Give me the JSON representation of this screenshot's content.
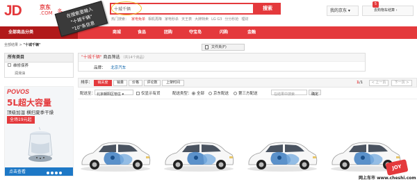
{
  "header": {
    "logo": {
      "brand": "JD",
      "cn": "京东",
      "com": ".COM",
      "more": "多"
    },
    "search": {
      "value": "十城千辆",
      "button": "搜索"
    },
    "hot_words": [
      {
        "text": "热门搜索：",
        "hot": false
      },
      {
        "text": "家电免单",
        "hot": true
      },
      {
        "text": "相机再降",
        "hot": false
      },
      {
        "text": "家电秒杀",
        "hot": false
      },
      {
        "text": "天王表",
        "hot": false
      },
      {
        "text": "大牌特卖",
        "hot": false
      },
      {
        "text": "LG G3",
        "hot": false
      },
      {
        "text": "分分秒抢",
        "hot": false
      },
      {
        "text": "理财",
        "hot": false
      }
    ],
    "my_jd": "我的京东 ▾",
    "cart": {
      "label": "去购物车结算 ›",
      "count": "5"
    }
  },
  "overlay": {
    "lines": [
      "在搜索里输入",
      "\"十城千辆\"",
      "\"10\"条信息"
    ]
  },
  "nav": {
    "all_categories": "全部商品分类",
    "items": [
      "商城",
      "食品",
      "团购",
      "夺宝岛",
      "闪购",
      "金融"
    ]
  },
  "breadcrumb": {
    "prefix": "全部结果",
    "sep": " > ",
    "keyword": "\"十城千辆\""
  },
  "file_button": "文件夹(F)",
  "sidebar": {
    "title": "所有类目",
    "item": "维修保养",
    "sub": "润滑油"
  },
  "ad": {
    "brand": "POVOS",
    "headline": "5L超大容量",
    "sub": "顶级加湿 横扫夏季干燥",
    "price": "全场19元起",
    "footer": "点击查看"
  },
  "filter": {
    "keyword": "\"十城千辆\"",
    "label": "商品筛选",
    "count": "（共14个商品）",
    "brand_label": "品牌：",
    "brand_value": "北京汽车"
  },
  "sort": {
    "label": "排序：",
    "buttons": [
      "销关度",
      "销量",
      "价格",
      "评论数",
      "上架时间"
    ],
    "page": {
      "current": "1",
      "total": "/1"
    },
    "prev": "< 上一页",
    "next": "下一页 >"
  },
  "delivery": {
    "label": "配送至：",
    "region": "北京朝阳区管庄 ▾",
    "stock_only": "仅显示有货",
    "type_label": "配送类型：",
    "options": [
      "全部",
      "京东配送",
      "第三方配送"
    ],
    "store_placeholder": "在结果中搜索",
    "confirm": "确定"
  },
  "products": {
    "count": 4
  },
  "watermark": {
    "joy": "JOY",
    "text": "网上车市  www.cheshi.com"
  },
  "colors": {
    "brand_red": "#e4393c",
    "nav_dark": "#b1191a",
    "link_blue": "#005ea7"
  }
}
